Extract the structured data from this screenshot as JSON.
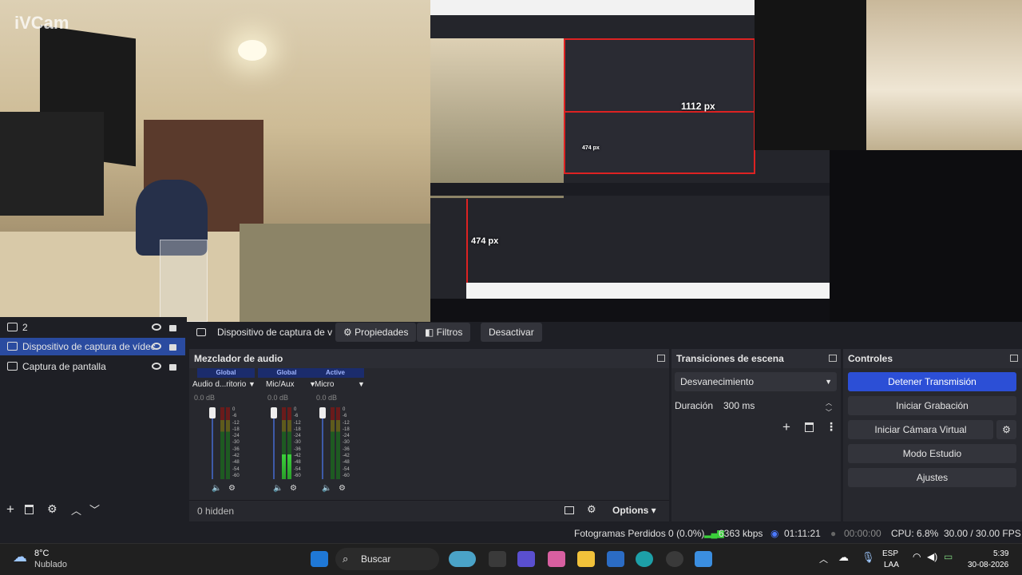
{
  "preview": {
    "watermark": "iVCam",
    "nested_label_1": "1112 px",
    "nested_label_2": "474 px",
    "nested_label_3": "474 px"
  },
  "sources": [
    {
      "label": "2"
    },
    {
      "label": "Dispositivo de captura de vídec"
    },
    {
      "label": "Captura de pantalla"
    }
  ],
  "source_toolbar": {
    "current_source": "Dispositivo de captura de v",
    "properties": "Propiedades",
    "filters": "Filtros",
    "deactivate": "Desactivar"
  },
  "mixer": {
    "title": "Mezclador de audio",
    "channels": [
      {
        "tag": "Global",
        "name": "Audio d...ritorio",
        "db": "0.0 dB",
        "level": 0
      },
      {
        "tag": "Global",
        "name": "Mic/Aux",
        "db": "0.0 dB",
        "level": 0.35
      },
      {
        "tag": "Active",
        "name": "Micro",
        "db": "0.0 dB",
        "level": 0
      }
    ],
    "scale": [
      "0",
      "-6",
      "-12",
      "-18",
      "-24",
      "-30",
      "-36",
      "-42",
      "-48",
      "-54",
      "-60"
    ],
    "hidden": "0 hidden",
    "options": "Options"
  },
  "transitions": {
    "title": "Transiciones de escena",
    "selected": "Desvanecimiento",
    "duration_label": "Duración",
    "duration_value": "300 ms"
  },
  "controls": {
    "title": "Controles",
    "stop_stream": "Detener Transmisión",
    "start_recording": "Iniciar Grabación",
    "start_virtual_cam": "Iniciar Cámara Virtual",
    "studio_mode": "Modo Estudio",
    "settings": "Ajustes"
  },
  "statusbar": {
    "dropped": "Fotogramas Perdidos 0 (0.0%)",
    "bitrate": "6363 kbps",
    "stream_time": "01:11:21",
    "rec_time": "00:00:00",
    "cpu": "CPU: 6.8%",
    "fps": "30.00 / 30.00 FPS"
  },
  "taskbar": {
    "temp": "8°C",
    "weather": "Nublado",
    "search": "Buscar",
    "lang1": "ESP",
    "lang2": "LAA",
    "time": "5:39",
    "date": "30-08-2026"
  },
  "colors": {
    "accent": "#2c4fd6",
    "selection": "#2a4ba0",
    "panel": "#27282e",
    "background": "#1e1f25"
  }
}
